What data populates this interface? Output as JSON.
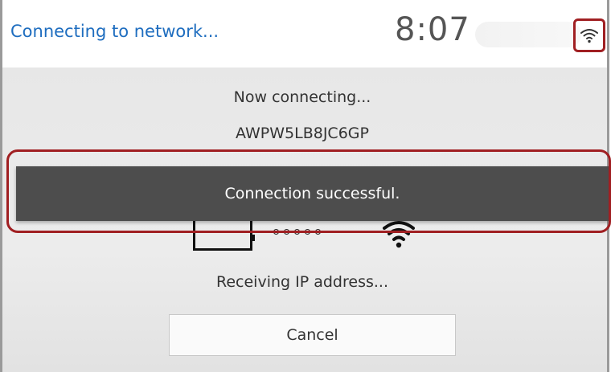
{
  "header": {
    "title": "Connecting to network...",
    "time": "8:07",
    "wifi_status_icon": "wifi-icon"
  },
  "main": {
    "status_line": "Now connecting...",
    "network_name": "AWPW5LB8JC6GP",
    "progress_line": "Receiving IP address...",
    "cancel_label": "Cancel",
    "device_icon": "tablet-device-icon",
    "progress_dots_icon": "progress-dots-icon",
    "target_wifi_icon": "wifi-icon"
  },
  "toast": {
    "message": "Connection successful."
  },
  "colors": {
    "title": "#1e6dbf",
    "toast_bg": "#4d4d4d",
    "highlight": "#a01f22"
  }
}
